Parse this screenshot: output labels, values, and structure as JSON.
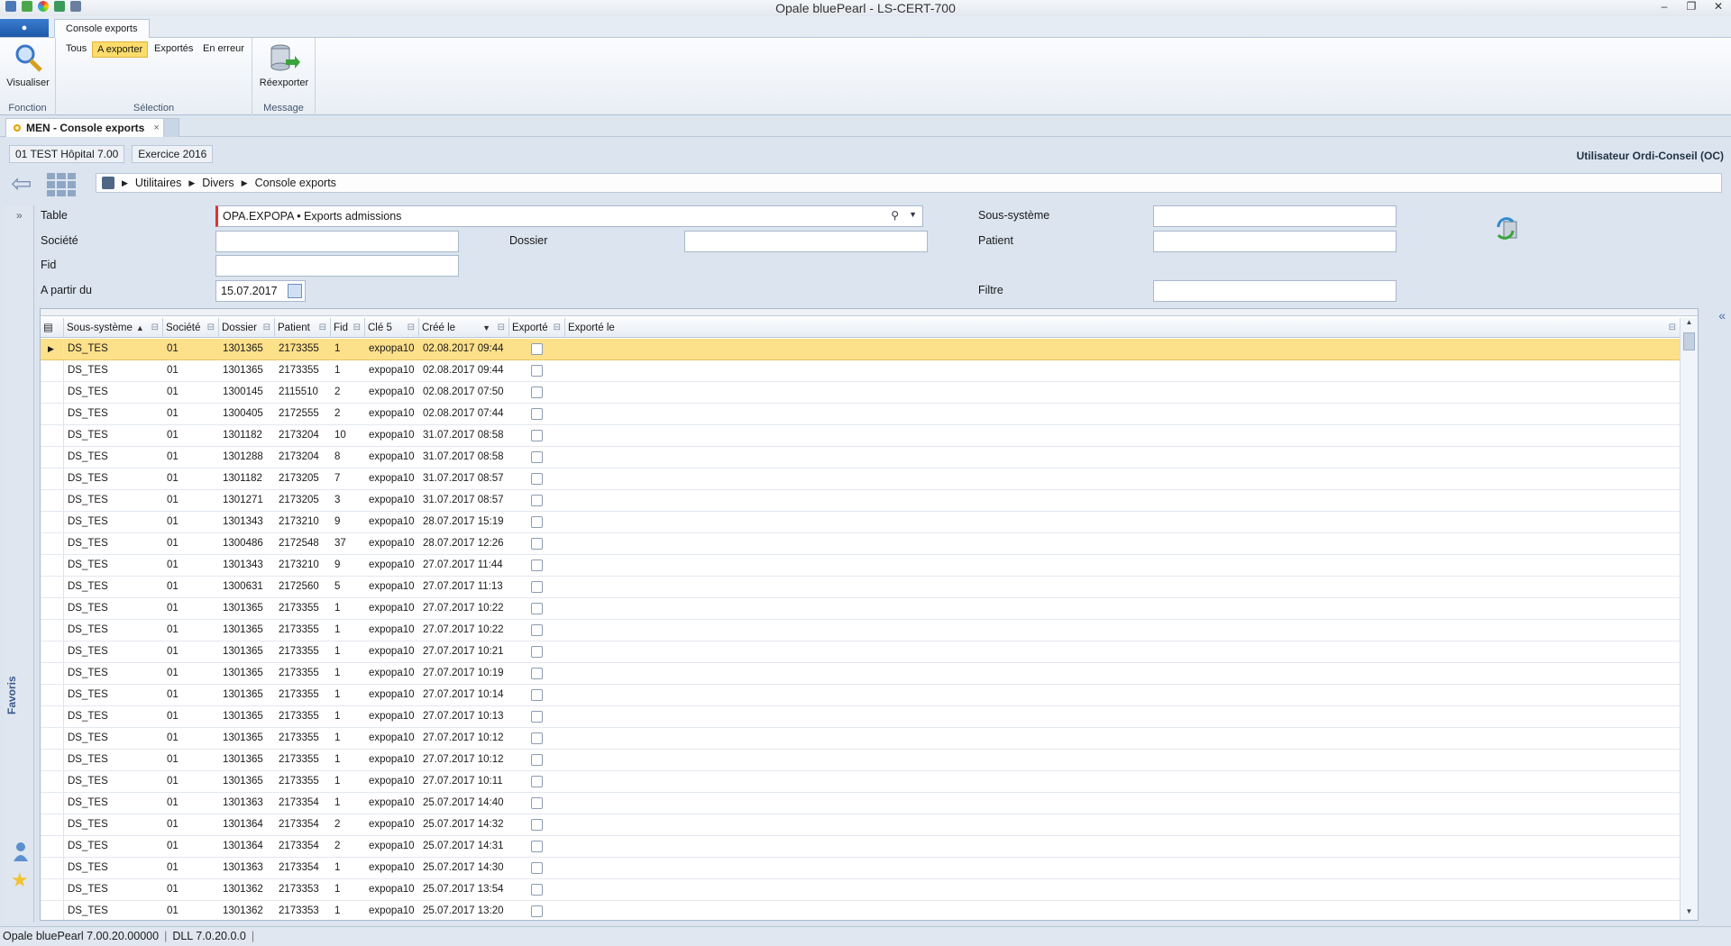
{
  "window": {
    "title": "Opale bluePearl  -  LS-CERT-700"
  },
  "ribbon": {
    "tab": "Console exports",
    "groups": {
      "fonction": {
        "label": "Fonction",
        "visualiser": "Visualiser"
      },
      "selection": {
        "label": "Sélection",
        "tous": "Tous",
        "a_exporter": "A exporter",
        "exportes": "Exportés",
        "en_erreur": "En erreur"
      },
      "message": {
        "label": "Message",
        "reexporter": "Réexporter"
      }
    }
  },
  "doc_tab": {
    "label": "MEN - Console exports",
    "close": "×"
  },
  "context": {
    "company": "01 TEST Hôpital 7.00",
    "year": "Exercice 2016",
    "user": "Utilisateur Ordi-Conseil (OC)"
  },
  "breadcrumb": [
    "Utilitaires",
    "Divers",
    "Console exports"
  ],
  "rail": {
    "favoris": "Favoris"
  },
  "form": {
    "table_label": "Table",
    "table_value": "OPA.EXPOPA • Exports admissions",
    "societe_label": "Société",
    "societe_value": "",
    "fid_label": "Fid",
    "fid_value": "",
    "apartir_label": "A partir du",
    "apartir_value": "15.07.2017",
    "dossier_label": "Dossier",
    "dossier_value": "",
    "soussysteme_label": "Sous-système",
    "soussysteme_value": "",
    "patient_label": "Patient",
    "patient_value": "",
    "filtre_label": "Filtre",
    "filtre_value": ""
  },
  "grid": {
    "columns": [
      "Sous-système",
      "Société",
      "Dossier",
      "Patient",
      "Fid",
      "Clé 5",
      "Créé le",
      "Exporté",
      "Exporté le"
    ],
    "rows": [
      [
        "DS_TES",
        "01",
        "1301365",
        "2173355",
        "1",
        "expopa10",
        "02.08.2017 09:44"
      ],
      [
        "DS_TES",
        "01",
        "1301365",
        "2173355",
        "1",
        "expopa10",
        "02.08.2017 09:44"
      ],
      [
        "DS_TES",
        "01",
        "1300145",
        "2115510",
        "2",
        "expopa10",
        "02.08.2017 07:50"
      ],
      [
        "DS_TES",
        "01",
        "1300405",
        "2172555",
        "2",
        "expopa10",
        "02.08.2017 07:44"
      ],
      [
        "DS_TES",
        "01",
        "1301182",
        "2173204",
        "10",
        "expopa10",
        "31.07.2017 08:58"
      ],
      [
        "DS_TES",
        "01",
        "1301288",
        "2173204",
        "8",
        "expopa10",
        "31.07.2017 08:58"
      ],
      [
        "DS_TES",
        "01",
        "1301182",
        "2173205",
        "7",
        "expopa10",
        "31.07.2017 08:57"
      ],
      [
        "DS_TES",
        "01",
        "1301271",
        "2173205",
        "3",
        "expopa10",
        "31.07.2017 08:57"
      ],
      [
        "DS_TES",
        "01",
        "1301343",
        "2173210",
        "9",
        "expopa10",
        "28.07.2017 15:19"
      ],
      [
        "DS_TES",
        "01",
        "1300486",
        "2172548",
        "37",
        "expopa10",
        "28.07.2017 12:26"
      ],
      [
        "DS_TES",
        "01",
        "1301343",
        "2173210",
        "9",
        "expopa10",
        "27.07.2017 11:44"
      ],
      [
        "DS_TES",
        "01",
        "1300631",
        "2172560",
        "5",
        "expopa10",
        "27.07.2017 11:13"
      ],
      [
        "DS_TES",
        "01",
        "1301365",
        "2173355",
        "1",
        "expopa10",
        "27.07.2017 10:22"
      ],
      [
        "DS_TES",
        "01",
        "1301365",
        "2173355",
        "1",
        "expopa10",
        "27.07.2017 10:22"
      ],
      [
        "DS_TES",
        "01",
        "1301365",
        "2173355",
        "1",
        "expopa10",
        "27.07.2017 10:21"
      ],
      [
        "DS_TES",
        "01",
        "1301365",
        "2173355",
        "1",
        "expopa10",
        "27.07.2017 10:19"
      ],
      [
        "DS_TES",
        "01",
        "1301365",
        "2173355",
        "1",
        "expopa10",
        "27.07.2017 10:14"
      ],
      [
        "DS_TES",
        "01",
        "1301365",
        "2173355",
        "1",
        "expopa10",
        "27.07.2017 10:13"
      ],
      [
        "DS_TES",
        "01",
        "1301365",
        "2173355",
        "1",
        "expopa10",
        "27.07.2017 10:12"
      ],
      [
        "DS_TES",
        "01",
        "1301365",
        "2173355",
        "1",
        "expopa10",
        "27.07.2017 10:12"
      ],
      [
        "DS_TES",
        "01",
        "1301365",
        "2173355",
        "1",
        "expopa10",
        "27.07.2017 10:11"
      ],
      [
        "DS_TES",
        "01",
        "1301363",
        "2173354",
        "1",
        "expopa10",
        "25.07.2017 14:40"
      ],
      [
        "DS_TES",
        "01",
        "1301364",
        "2173354",
        "2",
        "expopa10",
        "25.07.2017 14:32"
      ],
      [
        "DS_TES",
        "01",
        "1301364",
        "2173354",
        "2",
        "expopa10",
        "25.07.2017 14:31"
      ],
      [
        "DS_TES",
        "01",
        "1301363",
        "2173354",
        "1",
        "expopa10",
        "25.07.2017 14:30"
      ],
      [
        "DS_TES",
        "01",
        "1301362",
        "2173353",
        "1",
        "expopa10",
        "25.07.2017 13:54"
      ],
      [
        "DS_TES",
        "01",
        "1301362",
        "2173353",
        "1",
        "expopa10",
        "25.07.2017 13:20"
      ]
    ]
  },
  "status": {
    "version": "Opale bluePearl 7.00.20.00000",
    "dll": "DLL 7.0.20.0.0"
  },
  "colors": {
    "selected_row": "#fde08a",
    "active_filter": "#fcdc6a",
    "accent": "#1d5aa8"
  }
}
